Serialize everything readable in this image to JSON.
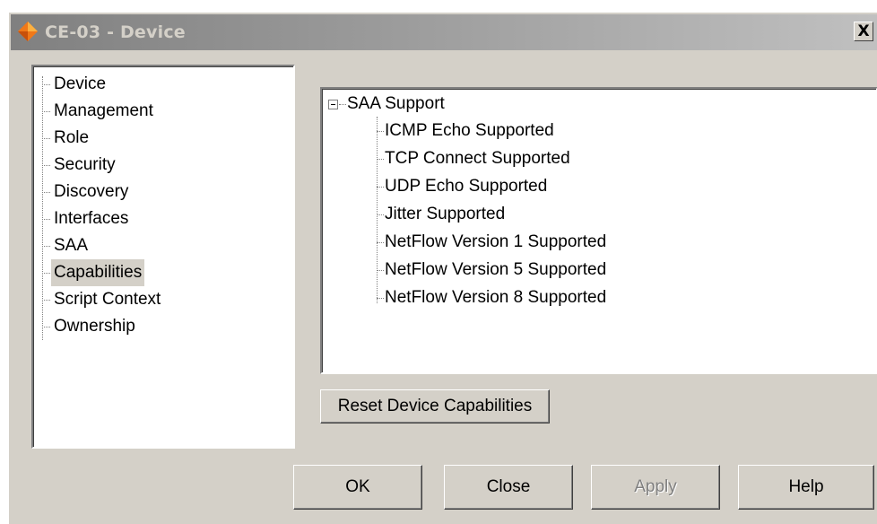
{
  "window": {
    "title": "CE-03 - Device",
    "close_glyph": "X",
    "icon": "orange-diamond-icon"
  },
  "nav_tree": {
    "items": [
      {
        "label": "Device",
        "selected": false
      },
      {
        "label": "Management",
        "selected": false
      },
      {
        "label": "Role",
        "selected": false
      },
      {
        "label": "Security",
        "selected": false
      },
      {
        "label": "Discovery",
        "selected": false
      },
      {
        "label": "Interfaces",
        "selected": false
      },
      {
        "label": "SAA",
        "selected": false
      },
      {
        "label": "Capabilities",
        "selected": true
      },
      {
        "label": "Script Context",
        "selected": false
      },
      {
        "label": "Ownership",
        "selected": false
      }
    ]
  },
  "capabilities_tree": {
    "root": {
      "label": "SAA Support",
      "expanded": true
    },
    "children": [
      "ICMP Echo Supported",
      "TCP Connect Supported",
      "UDP Echo Supported",
      "Jitter Supported",
      "NetFlow Version 1 Supported",
      "NetFlow Version 5 Supported",
      "NetFlow Version 8 Supported"
    ]
  },
  "buttons": {
    "reset": "Reset Device Capabilities",
    "ok": "OK",
    "close": "Close",
    "apply": "Apply",
    "apply_enabled": false,
    "help": "Help"
  },
  "colors": {
    "dialog_face": "#d4d0c8",
    "title_gradient_start": "#808080",
    "title_gradient_end": "#c0c0c0",
    "icon_orange": "#f07818"
  }
}
